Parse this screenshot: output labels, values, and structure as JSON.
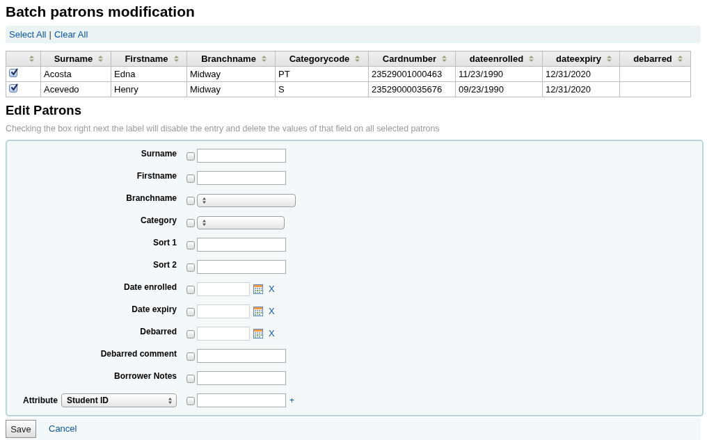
{
  "page_title": "Batch patrons modification",
  "selection_links": {
    "select_all": "Select All",
    "separator": "|",
    "clear_all": "Clear All"
  },
  "table": {
    "columns": [
      "Surname",
      "Firstname",
      "Branchname",
      "Categorycode",
      "Cardnumber",
      "dateenrolled",
      "dateexpiry",
      "debarred"
    ],
    "rows": [
      {
        "selected": true,
        "cells": [
          "Acosta",
          "Edna",
          "Midway",
          "PT",
          "23529001000463",
          "11/23/1990",
          "12/31/2020"
        ]
      },
      {
        "selected": true,
        "cells": [
          "Acevedo",
          "Henry",
          "Midway",
          "S",
          "23529000035676",
          "09/23/1990",
          "12/31/2020"
        ]
      }
    ]
  },
  "edit_section": {
    "title": "Edit Patrons",
    "hint": "Checking the box right next the label will disable the entry and delete the values of that field on all selected patrons"
  },
  "fields": [
    {
      "kind": "text",
      "label": "Surname",
      "checked": false
    },
    {
      "kind": "text",
      "label": "Firstname",
      "checked": false
    },
    {
      "kind": "select",
      "label": "Branchname",
      "checked": false
    },
    {
      "kind": "select",
      "label": "Category",
      "checked": false
    },
    {
      "kind": "text",
      "label": "Sort 1",
      "checked": false
    },
    {
      "kind": "text",
      "label": "Sort 2",
      "checked": false
    },
    {
      "kind": "date",
      "label": "Date enrolled",
      "checked": false,
      "clear": "X"
    },
    {
      "kind": "date",
      "label": "Date expiry",
      "checked": false,
      "clear": "X"
    },
    {
      "kind": "date",
      "label": "Debarred",
      "checked": false,
      "clear": "X"
    },
    {
      "kind": "text",
      "label": "Debarred comment",
      "checked": false
    },
    {
      "kind": "text",
      "label": "Borrower Notes",
      "checked": false
    },
    {
      "kind": "attribute",
      "label": "Attribute",
      "attribute": "Student ID",
      "checked": false,
      "add": "+"
    }
  ],
  "actions": {
    "save": "Save",
    "cancel": "Cancel"
  }
}
